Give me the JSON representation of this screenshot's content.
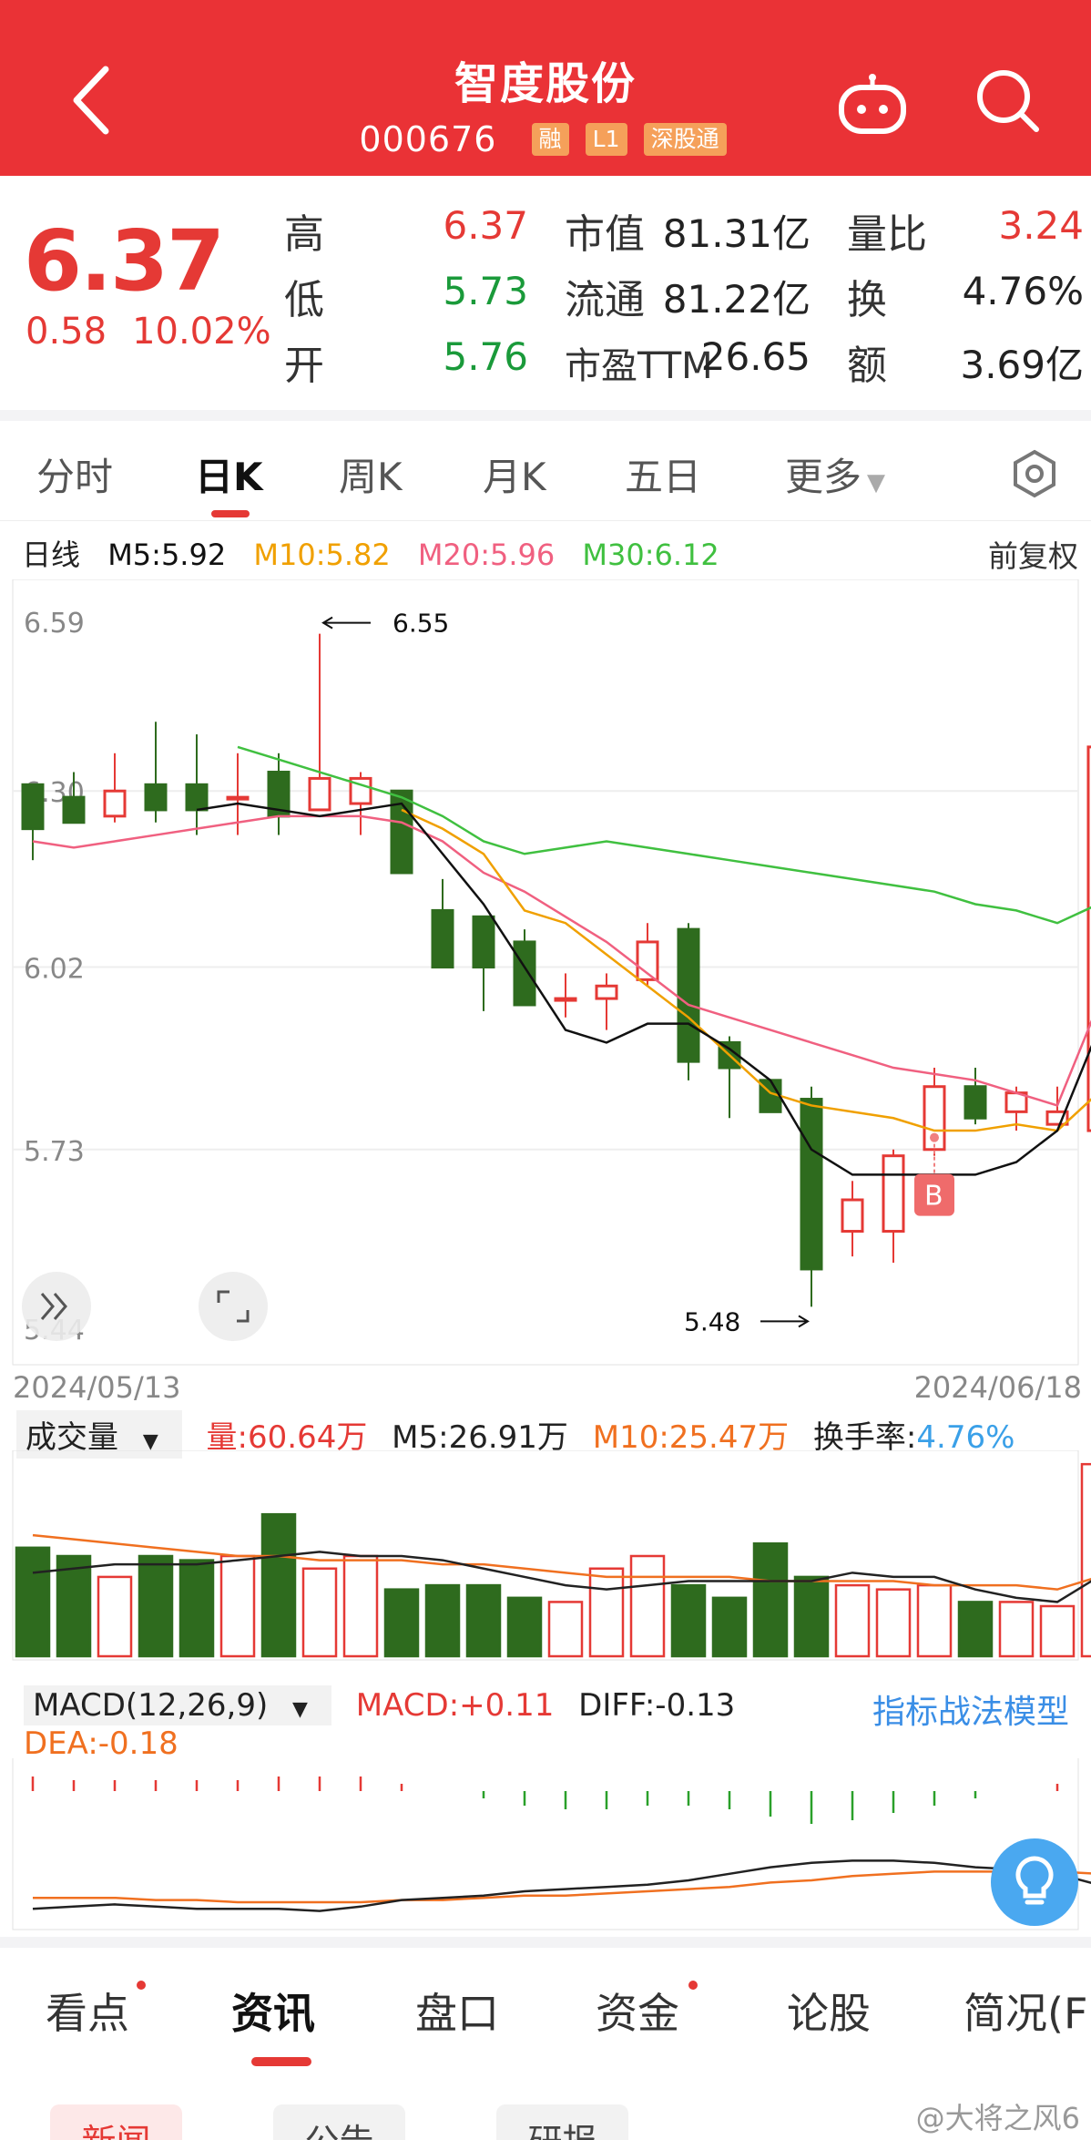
{
  "header": {
    "title": "智度股份",
    "code": "000676",
    "tags": [
      "融",
      "L1",
      "深股通"
    ]
  },
  "quote": {
    "price": "6.37",
    "change": "0.58",
    "change_pct": "10.02%",
    "high_label": "高",
    "high": "6.37",
    "low_label": "低",
    "low": "5.73",
    "open_label": "开",
    "open": "5.76",
    "mktcap_label": "市值",
    "mktcap": "81.31亿",
    "float_label": "流通",
    "float": "81.22亿",
    "pe_label": "市盈TTM",
    "pe": "26.65",
    "volratio_label": "量比",
    "volratio": "3.24",
    "turnover_label": "换",
    "turnover": "4.76%",
    "amount_label": "额",
    "amount": "3.69亿"
  },
  "tabs": [
    "分时",
    "日K",
    "周K",
    "月K",
    "五日",
    "更多"
  ],
  "active_tab": "日K",
  "ma_legend": {
    "daily": "日线",
    "m5": "M5:5.92",
    "m10": "M10:5.82",
    "m20": "M20:5.96",
    "m30": "M30:6.12",
    "adjust": "前复权"
  },
  "colors": {
    "up": "#e53935",
    "down": "#2e6b1e",
    "m5": "#111111",
    "m10": "#f0a000",
    "m20": "#f06080",
    "m30": "#40c040",
    "header": "#ea3236"
  },
  "chart_data": {
    "type": "candlestick",
    "y_ticks": [
      "6.59",
      "6.30",
      "6.02",
      "5.73",
      "5.44"
    ],
    "ylim": [
      5.44,
      6.59
    ],
    "start_date": "2024/05/13",
    "end_date": "2024/06/18",
    "max_label": "6.55",
    "min_label": "5.48",
    "signal_label": "B",
    "candles": [
      {
        "o": 6.31,
        "c": 6.24,
        "h": 6.31,
        "l": 6.19
      },
      {
        "o": 6.29,
        "c": 6.25,
        "h": 6.33,
        "l": 6.25
      },
      {
        "o": 6.26,
        "c": 6.3,
        "h": 6.36,
        "l": 6.25
      },
      {
        "o": 6.31,
        "c": 6.27,
        "h": 6.41,
        "l": 6.25
      },
      {
        "o": 6.31,
        "c": 6.27,
        "h": 6.39,
        "l": 6.23
      },
      {
        "o": 6.29,
        "c": 6.29,
        "h": 6.36,
        "l": 6.23
      },
      {
        "o": 6.33,
        "c": 6.26,
        "h": 6.36,
        "l": 6.23
      },
      {
        "o": 6.27,
        "c": 6.32,
        "h": 6.55,
        "l": 6.27
      },
      {
        "o": 6.28,
        "c": 6.32,
        "h": 6.33,
        "l": 6.23
      },
      {
        "o": 6.3,
        "c": 6.17,
        "h": 6.3,
        "l": 6.17
      },
      {
        "o": 6.11,
        "c": 6.02,
        "h": 6.16,
        "l": 6.02
      },
      {
        "o": 6.1,
        "c": 6.02,
        "h": 6.1,
        "l": 5.95
      },
      {
        "o": 6.06,
        "c": 5.96,
        "h": 6.08,
        "l": 5.96
      },
      {
        "o": 5.97,
        "c": 5.97,
        "h": 6.01,
        "l": 5.94
      },
      {
        "o": 5.97,
        "c": 5.99,
        "h": 6.01,
        "l": 5.92
      },
      {
        "o": 6.0,
        "c": 6.06,
        "h": 6.09,
        "l": 5.99
      },
      {
        "o": 6.08,
        "c": 5.87,
        "h": 6.09,
        "l": 5.84
      },
      {
        "o": 5.9,
        "c": 5.86,
        "h": 5.91,
        "l": 5.78
      },
      {
        "o": 5.84,
        "c": 5.79,
        "h": 5.84,
        "l": 5.79
      },
      {
        "o": 5.81,
        "c": 5.54,
        "h": 5.83,
        "l": 5.48
      },
      {
        "o": 5.6,
        "c": 5.65,
        "h": 5.68,
        "l": 5.56
      },
      {
        "o": 5.6,
        "c": 5.72,
        "h": 5.73,
        "l": 5.55
      },
      {
        "o": 5.73,
        "c": 5.83,
        "h": 5.86,
        "l": 5.72
      },
      {
        "o": 5.83,
        "c": 5.78,
        "h": 5.86,
        "l": 5.77
      },
      {
        "o": 5.79,
        "c": 5.82,
        "h": 5.83,
        "l": 5.76
      },
      {
        "o": 5.77,
        "c": 5.79,
        "h": 5.83,
        "l": 5.77
      },
      {
        "o": 5.76,
        "c": 6.37,
        "h": 6.37,
        "l": 5.73
      }
    ],
    "ma5": [
      null,
      null,
      null,
      null,
      6.27,
      6.28,
      6.27,
      6.26,
      6.27,
      6.28,
      6.2,
      6.12,
      6.02,
      5.92,
      5.9,
      5.93,
      5.93,
      5.89,
      5.84,
      5.73,
      5.69,
      5.69,
      5.69,
      5.69,
      5.71,
      5.76,
      5.92
    ],
    "ma10": [
      null,
      null,
      null,
      null,
      null,
      null,
      null,
      null,
      null,
      6.27,
      6.24,
      6.2,
      6.11,
      6.09,
      6.04,
      5.99,
      5.94,
      5.88,
      5.82,
      5.8,
      5.79,
      5.78,
      5.76,
      5.76,
      5.77,
      5.76,
      5.82
    ],
    "ma20": [
      6.22,
      6.21,
      6.22,
      6.23,
      6.24,
      6.25,
      6.26,
      6.26,
      6.26,
      6.25,
      6.22,
      6.17,
      6.14,
      6.1,
      6.06,
      6.01,
      5.96,
      5.94,
      5.92,
      5.9,
      5.88,
      5.86,
      5.85,
      5.84,
      5.82,
      5.8,
      5.96
    ],
    "ma30": [
      null,
      null,
      null,
      null,
      null,
      6.37,
      6.35,
      6.33,
      6.31,
      6.29,
      6.26,
      6.22,
      6.2,
      6.21,
      6.22,
      6.21,
      6.2,
      6.19,
      6.18,
      6.17,
      6.16,
      6.15,
      6.14,
      6.12,
      6.11,
      6.09,
      6.12
    ]
  },
  "volume": {
    "selector": "成交量",
    "vol": "量:60.64万",
    "m5": "M5:26.91万",
    "m10": "M10:25.47万",
    "turnover_label": "换手率:",
    "turnover": "4.76%",
    "values": [
      26,
      24,
      19,
      24,
      23,
      24,
      34,
      21,
      24,
      16,
      17,
      17,
      14,
      13,
      21,
      24,
      17,
      14,
      27,
      19,
      17,
      16,
      17,
      13,
      13,
      12,
      46
    ],
    "m5_line": [
      20,
      21,
      22,
      22,
      22,
      23,
      24,
      25,
      24,
      24,
      23,
      21,
      19,
      17,
      16,
      17,
      18,
      18,
      18,
      18,
      20,
      19,
      19,
      16,
      14,
      13,
      19
    ],
    "m10_line": [
      29,
      28,
      27,
      26,
      25,
      24,
      24,
      23,
      23,
      23,
      22,
      22,
      21,
      20,
      19,
      19,
      19,
      19,
      18,
      18,
      18,
      18,
      17,
      17,
      17,
      16,
      19
    ]
  },
  "macd": {
    "selector": "MACD(12,26,9)",
    "macd": "MACD:+0.11",
    "diff": "DIFF:-0.13",
    "dea": "DEA:-0.18",
    "model_link": "指标战法模型",
    "hist": [
      0.04,
      0.03,
      0.03,
      0.03,
      0.03,
      0.03,
      0.04,
      0.04,
      0.04,
      0.02,
      0.0,
      -0.02,
      -0.04,
      -0.05,
      -0.05,
      -0.04,
      -0.04,
      -0.05,
      -0.07,
      -0.09,
      -0.08,
      -0.06,
      -0.04,
      -0.02,
      0.0,
      0.02,
      0.11
    ],
    "diff_line": [
      -0.02,
      -0.03,
      -0.04,
      -0.03,
      -0.02,
      -0.02,
      -0.02,
      -0.01,
      -0.03,
      -0.06,
      -0.07,
      -0.08,
      -0.1,
      -0.11,
      -0.12,
      -0.13,
      -0.15,
      -0.18,
      -0.21,
      -0.23,
      -0.24,
      -0.24,
      -0.23,
      -0.21,
      -0.2,
      -0.18,
      -0.13
    ],
    "dea_line": [
      -0.07,
      -0.07,
      -0.07,
      -0.06,
      -0.06,
      -0.05,
      -0.05,
      -0.05,
      -0.05,
      -0.06,
      -0.06,
      -0.07,
      -0.08,
      -0.08,
      -0.09,
      -0.1,
      -0.11,
      -0.12,
      -0.14,
      -0.15,
      -0.17,
      -0.18,
      -0.19,
      -0.19,
      -0.19,
      -0.19,
      -0.18
    ]
  },
  "bottom_tabs": [
    "看点",
    "资讯",
    "盘口",
    "资金",
    "论股",
    "简况(F"
  ],
  "sub_chips": [
    "新闻",
    "公告",
    "研报"
  ],
  "watermark": "@大将之风6"
}
